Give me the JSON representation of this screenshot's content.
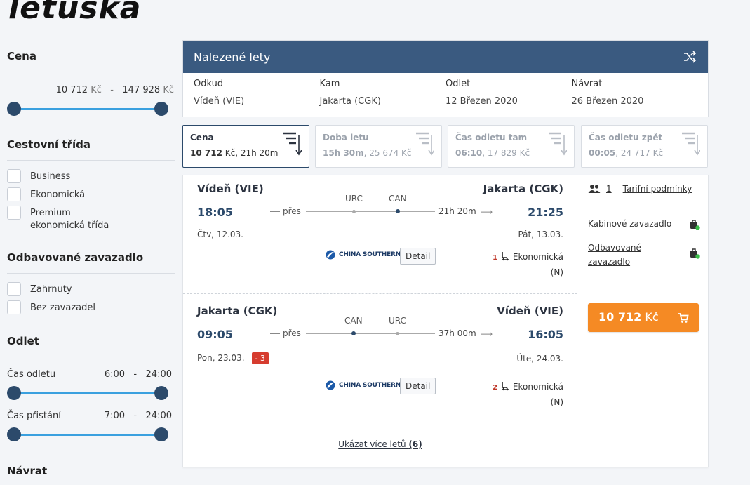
{
  "brand": {
    "logo_text": "letuška"
  },
  "sidebar": {
    "price": {
      "title": "Cena",
      "min_value": "10 712",
      "max_value": "147 928",
      "currency": "Kč",
      "separator": "-"
    },
    "travel_class": {
      "title": "Cestovní třída",
      "options": [
        "Business",
        "Ekonomická",
        "Premium ekonomická třída"
      ]
    },
    "baggage": {
      "title": "Odbavované zavazadlo",
      "options": [
        "Zahrnuty",
        "Bez zavazadel"
      ]
    },
    "departure": {
      "title": "Odlet",
      "dep_label": "Čas odletu",
      "dep_from": "6:00",
      "dep_to": "24:00",
      "arr_label": "Čas přistání",
      "arr_from": "7:00",
      "arr_to": "24:00",
      "separator": "-"
    },
    "return": {
      "title": "Návrat"
    }
  },
  "found": {
    "title": "Nalezené lety",
    "columns": [
      {
        "label": "Odkud",
        "value": "Vídeň (VIE)"
      },
      {
        "label": "Kam",
        "value": "Jakarta (CGK)"
      },
      {
        "label": "Odlet",
        "value": "12 Březen 2020"
      },
      {
        "label": "Návrat",
        "value": "26 Březen 2020"
      }
    ]
  },
  "sort_tabs": [
    {
      "title": "Cena",
      "main": "10 712",
      "rest": " Kč, 21h 20m",
      "active": true
    },
    {
      "title": "Doba letu",
      "main": "15h 30m",
      "rest": ", 25 674  Kč",
      "active": false
    },
    {
      "title": "Čas odletu tam",
      "main": "06:10",
      "rest": ", 17 829  Kč",
      "active": false
    },
    {
      "title": "Čas odletu zpět",
      "main": "00:05",
      "rest": ", 24 717  Kč",
      "active": false
    }
  ],
  "legs": [
    {
      "from": "Vídeň (VIE)",
      "to": "Jakarta (CGK)",
      "dep_time": "18:05",
      "arr_time": "21:25",
      "dep_date": "Čtv, 12.03.",
      "arr_date": "Pát, 13.03.",
      "via": "přes",
      "stop1": "URC",
      "stop2": "CAN",
      "duration": "21h 20m",
      "day_badge": "",
      "airline": "CHINA SOUTHERN",
      "detail": "Detail",
      "seats": "1",
      "class": "Ekonomická",
      "fare": "(N)"
    },
    {
      "from": "Jakarta (CGK)",
      "to": "Vídeň (VIE)",
      "dep_time": "09:05",
      "arr_time": "16:05",
      "dep_date": "Pon, 23.03.",
      "arr_date": "Úte, 24.03.",
      "via": "přes",
      "stop1": "CAN",
      "stop2": "URC",
      "duration": "37h 00m",
      "day_badge": "- 3",
      "airline": "CHINA SOUTHERN",
      "detail": "Detail",
      "seats": "2",
      "class": "Ekonomická",
      "fare": "(N)"
    }
  ],
  "more": {
    "text": "Ukázat více letů ",
    "count": "(6)"
  },
  "side": {
    "passengers": "1",
    "tariff_link": "Tarifní podmínky",
    "cabin_bag": "Kabinové zavazadlo",
    "checked_bag": "Odbavované zavazadlo",
    "price": "10 712",
    "currency": "Kč"
  },
  "colors": {
    "header": "#3a5a80",
    "accent_blue": "#3aa0df",
    "knob": "#2c4a6b",
    "price_button": "#f58a24",
    "badge_red": "#d63c2f"
  }
}
